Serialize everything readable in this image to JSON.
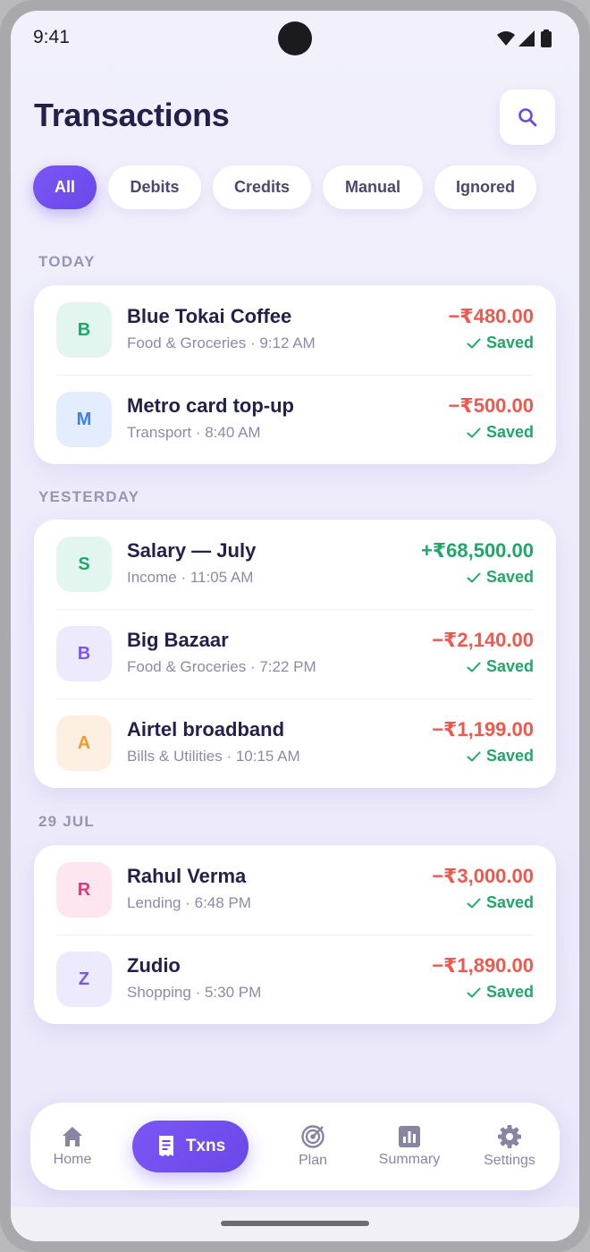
{
  "status_bar": {
    "time": "9:41",
    "icons": [
      "wifi-icon",
      "signal-icon",
      "battery-icon"
    ]
  },
  "header": {
    "title": "Transactions",
    "search_icon": "search-icon"
  },
  "filters": [
    {
      "label": "All",
      "active": true
    },
    {
      "label": "Debits",
      "active": false
    },
    {
      "label": "Credits",
      "active": false
    },
    {
      "label": "Manual",
      "active": false
    },
    {
      "label": "Ignored",
      "active": false
    }
  ],
  "sections": [
    {
      "label": "TODAY",
      "items": [
        {
          "initial": "B",
          "name": "Blue Tokai Coffee",
          "meta": "Food & Groceries · 9:12 AM",
          "amount": "−₹480.00",
          "direction": "debit",
          "status": "Saved",
          "avatar_bg": "#e2f6ef",
          "avatar_fg": "#1fa868"
        },
        {
          "initial": "M",
          "name": "Metro card top-up",
          "meta": "Transport · 8:40 AM",
          "amount": "−₹500.00",
          "direction": "debit",
          "status": "Saved",
          "avatar_bg": "#e3edfd",
          "avatar_fg": "#3f7df0"
        }
      ]
    },
    {
      "label": "YESTERDAY",
      "items": [
        {
          "initial": "S",
          "name": "Salary — July",
          "meta": "Income · 11:05 AM",
          "amount": "+₹68,500.00",
          "direction": "credit",
          "status": "Saved",
          "avatar_bg": "#e2f6ef",
          "avatar_fg": "#1fa868"
        },
        {
          "initial": "B",
          "name": "Big Bazaar",
          "meta": "Food & Groceries · 7:22 PM",
          "amount": "−₹2,140.00",
          "direction": "debit",
          "status": "Saved",
          "avatar_bg": "#eeeafd",
          "avatar_fg": "#7a57f5"
        },
        {
          "initial": "A",
          "name": "Airtel broadband",
          "meta": "Bills & Utilities · 10:15 AM",
          "amount": "−₹1,199.00",
          "direction": "debit",
          "status": "Saved",
          "avatar_bg": "#fdf0e2",
          "avatar_fg": "#ee9a2f"
        }
      ]
    },
    {
      "label": "29 JUL",
      "items": [
        {
          "initial": "R",
          "name": "Rahul Verma",
          "meta": "Lending · 6:48 PM",
          "amount": "−₹3,000.00",
          "direction": "debit",
          "status": "Saved",
          "avatar_bg": "#fde6ef",
          "avatar_fg": "#e0387a"
        },
        {
          "initial": "Z",
          "name": "Zudio",
          "meta": "Shopping · 5:30 PM",
          "amount": "−₹1,890.00",
          "direction": "debit",
          "status": "Saved",
          "avatar_bg": "#eeeafd",
          "avatar_fg": "#7a57f5"
        }
      ]
    }
  ],
  "bottom_nav": [
    {
      "label": "Home",
      "icon": "home-icon",
      "active": false
    },
    {
      "label": "Txns",
      "icon": "receipt-icon",
      "active": true
    },
    {
      "label": "Plan",
      "icon": "target-icon",
      "active": false
    },
    {
      "label": "Summary",
      "icon": "bar-chart-icon",
      "active": false
    },
    {
      "label": "Settings",
      "icon": "gear-icon",
      "active": false
    }
  ],
  "colors": {
    "accent": "#7a57f5",
    "debit": "#f0584f",
    "credit": "#1fa868",
    "title": "#23204a"
  }
}
